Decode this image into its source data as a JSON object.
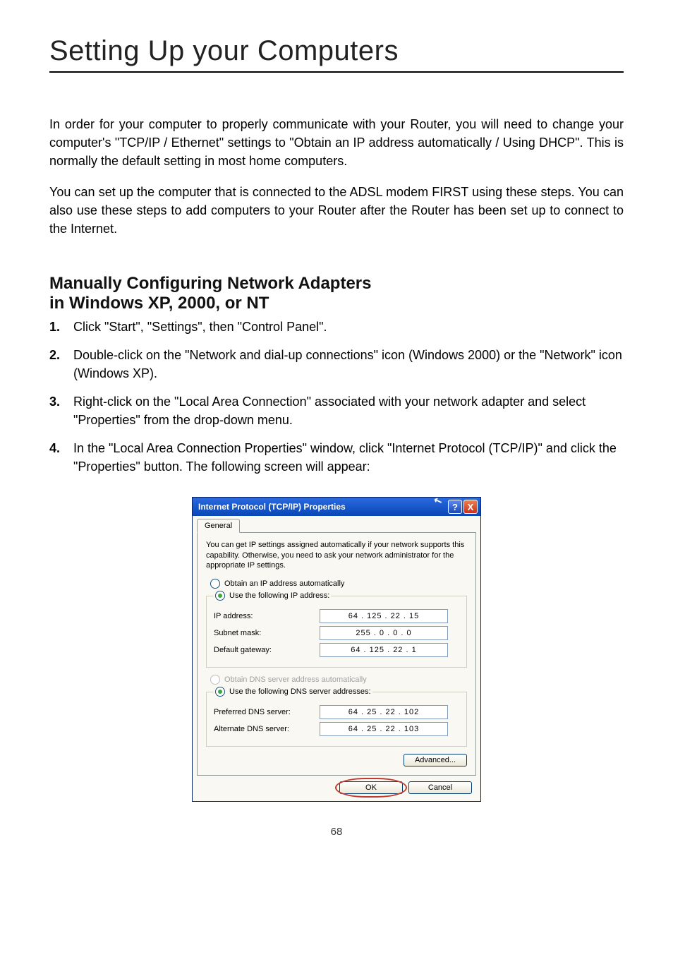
{
  "page": {
    "title": "Setting Up your Computers",
    "number": "68"
  },
  "paragraphs": {
    "p1": "In order for your computer to properly communicate with your Router, you will need to change your computer's \"TCP/IP / Ethernet\" settings to \"Obtain an IP address automatically / Using DHCP\". This is normally the default setting in most home computers.",
    "p2": "You can set up the computer that is connected to the ADSL modem FIRST using these steps. You can also use these steps to add computers to your Router after the Router has been set up to connect to the Internet."
  },
  "section": {
    "heading_line1": "Manually Configuring Network Adapters",
    "heading_line2": "in Windows XP, 2000, or NT"
  },
  "steps": [
    {
      "num": "1.",
      "text": "Click \"Start\", \"Settings\", then \"Control Panel\"."
    },
    {
      "num": "2.",
      "text": "Double-click on the \"Network and dial-up connections\" icon (Windows 2000) or the \"Network\" icon (Windows XP)."
    },
    {
      "num": "3.",
      "text": "Right-click on the \"Local Area Connection\" associated with your network adapter and select \"Properties\" from the drop-down menu."
    },
    {
      "num": "4.",
      "text": "In the \"Local Area Connection Properties\" window, click \"Internet Protocol (TCP/IP)\" and click the \"Properties\" button. The following screen will appear:"
    }
  ],
  "dialog": {
    "title": "Internet Protocol (TCP/IP) Properties",
    "help": "?",
    "close": "X",
    "tab": "General",
    "desc": "You can get IP settings assigned automatically if your network supports this capability. Otherwise, you need to ask your network administrator for the appropriate IP settings.",
    "radio_obtain_ip": "Obtain an IP address automatically",
    "radio_use_ip": "Use the following IP address:",
    "lbl_ip": "IP address:",
    "lbl_subnet": "Subnet mask:",
    "lbl_gateway": "Default gateway:",
    "ip_addr": "64 . 125 .  22  .  15",
    "subnet": "255 .   0  .   0   .   0",
    "gateway": "64 . 125 .  22  .   1",
    "radio_obtain_dns": "Obtain DNS server address automatically",
    "radio_use_dns": "Use the following DNS server addresses:",
    "lbl_pref_dns": "Preferred DNS server:",
    "lbl_alt_dns": "Alternate DNS server:",
    "pref_dns": "64  .  25  .  22  . 102",
    "alt_dns": "64  .  25  .  22  . 103",
    "btn_advanced": "Advanced...",
    "btn_ok": "OK",
    "btn_cancel": "Cancel"
  }
}
